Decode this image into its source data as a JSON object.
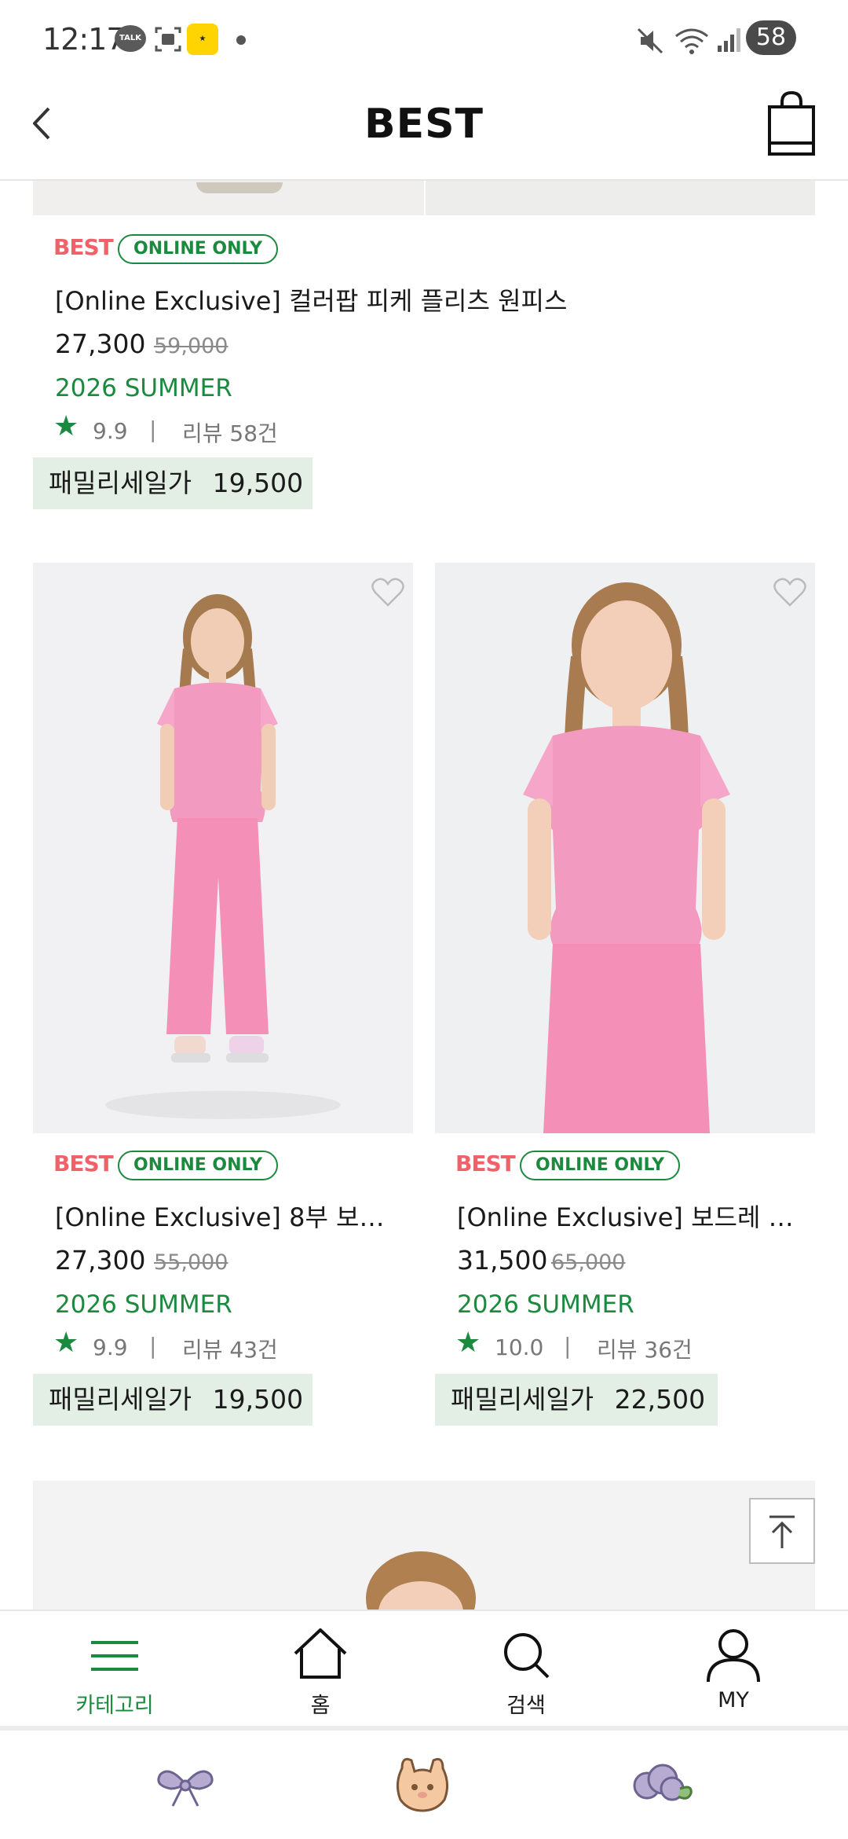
{
  "status_bar": {
    "time": "12:17",
    "talk_label": "TALK",
    "battery": "58"
  },
  "header": {
    "title": "BEST"
  },
  "products": [
    {
      "best": "BEST",
      "online": "ONLINE ONLY",
      "name": "[Online Exclusive] 컬러팝 피케 플리츠 원피스",
      "price": "27,300",
      "original_price": "59,000",
      "season": "2026 SUMMER",
      "rating": "9.9",
      "separator": "|",
      "review": "리뷰 58건",
      "family_label": "패밀리세일가",
      "family_price": "19,500"
    },
    {
      "best": "BEST",
      "online": "ONLINE ONLY",
      "name": "[Online Exclusive] 8부 보…",
      "price": "27,300",
      "original_price": "55,000",
      "season": "2026 SUMMER",
      "rating": "9.9",
      "separator": "|",
      "review": "리뷰 43건",
      "family_label": "패밀리세일가",
      "family_price": "19,500"
    },
    {
      "best": "BEST",
      "online": "ONLINE ONLY",
      "name": "[Online Exclusive] 보드레 …",
      "price": "31,500",
      "original_price": "65,000",
      "season": "2026 SUMMER",
      "rating": "10.0",
      "separator": "|",
      "review": "리뷰 36건",
      "family_label": "패밀리세일가",
      "family_price": "22,500"
    }
  ],
  "bottom_nav": {
    "items": [
      {
        "label": "카테고리",
        "icon": "menu-icon",
        "active": true
      },
      {
        "label": "홈",
        "icon": "home-icon",
        "active": false
      },
      {
        "label": "검색",
        "icon": "search-icon",
        "active": false
      },
      {
        "label": "MY",
        "icon": "person-icon",
        "active": false
      }
    ]
  },
  "colors": {
    "accent_green": "#1b8a3e",
    "best_red": "#f0616a",
    "family_bg": "#e3efe5",
    "dress_pink": "#f39ac0"
  }
}
